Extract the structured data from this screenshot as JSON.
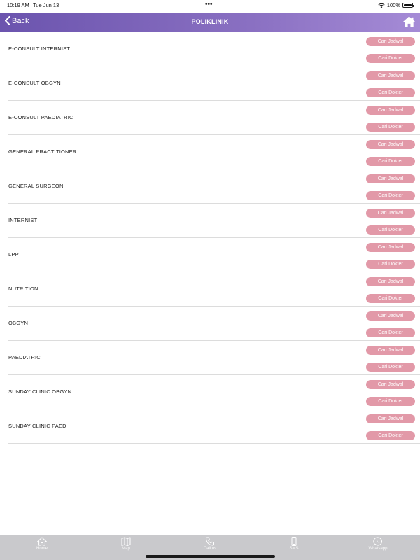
{
  "status_bar": {
    "time": "10:19 AM",
    "date": "Tue Jun 13",
    "battery_text": "100%",
    "battery_level": 1.0
  },
  "nav": {
    "back_label": "Back",
    "title": "POLIKLINIK",
    "bar_colors": [
      "#6b54ae",
      "#a58bd6"
    ]
  },
  "buttons": {
    "jadwal_label": "Cari Jadwal",
    "dokter_label": "Cari Dokter",
    "color": "#e299a8"
  },
  "clinics": [
    {
      "label": "E-CONSULT INTERNIST"
    },
    {
      "label": "E-CONSULT OBGYN"
    },
    {
      "label": "E-CONSULT PAEDIATRIC"
    },
    {
      "label": "GENERAL PRACTITIONER"
    },
    {
      "label": "GENERAL SURGEON"
    },
    {
      "label": "INTERNIST"
    },
    {
      "label": "LPP"
    },
    {
      "label": "NUTRITION"
    },
    {
      "label": "OBGYN"
    },
    {
      "label": "PAEDIATRIC"
    },
    {
      "label": "SUNDAY CLINIC OBGYN"
    },
    {
      "label": "SUNDAY CLINIC PAED"
    }
  ],
  "tabs": [
    {
      "label": "Home",
      "icon": "house-icon"
    },
    {
      "label": "Map",
      "icon": "map-icon"
    },
    {
      "label": "Call us",
      "icon": "phone-icon"
    },
    {
      "label": "SMS",
      "icon": "mobile-icon"
    },
    {
      "label": "Whatsapp",
      "icon": "whatsapp-icon"
    }
  ]
}
